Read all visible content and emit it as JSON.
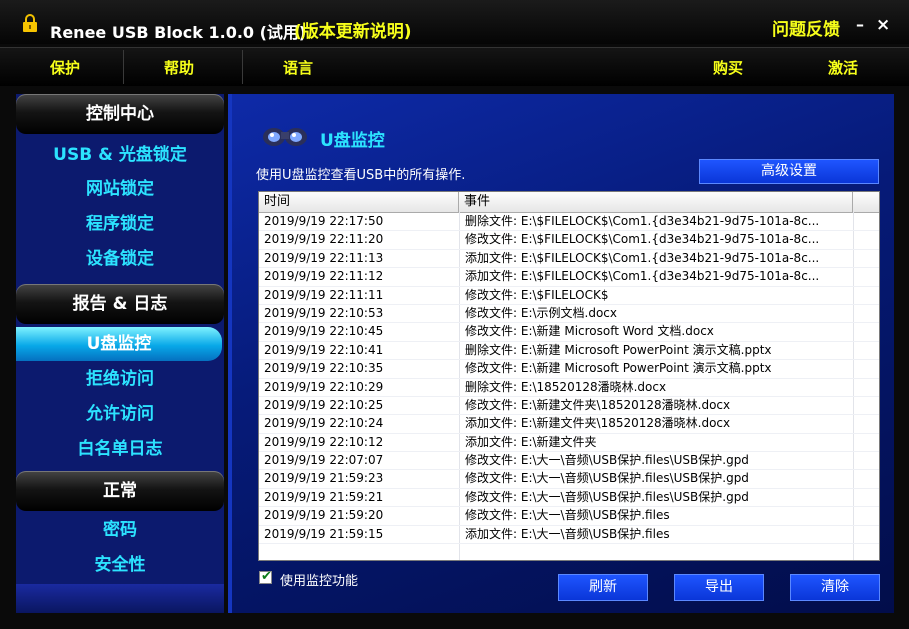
{
  "titlebar": {
    "app_name": "Renee USB Block 1.0.0 (试用)",
    "update_link": "(版本更新说明)",
    "feedback": "问题反馈",
    "minimize": "–",
    "close": "×"
  },
  "menu": {
    "protect": "保护",
    "help": "帮助",
    "language": "语言",
    "buy": "购买",
    "activate": "激活"
  },
  "sidebar": {
    "control_header": "控制中心",
    "control_items": [
      "USB & 光盘锁定",
      "网站锁定",
      "程序锁定",
      "设备锁定"
    ],
    "report_header": "报告 & 日志",
    "report_items": [
      "U盘监控",
      "拒绝访问",
      "允许访问",
      "白名单日志"
    ],
    "general_header": "正常",
    "general_items": [
      "密码",
      "安全性"
    ]
  },
  "main": {
    "title": "U盘监控",
    "description": "使用U盘监控查看USB中的所有操作.",
    "advanced_button": "高级设置",
    "columns": [
      "时间",
      "事件"
    ],
    "rows": [
      {
        "time": "2019/9/19 22:17:50",
        "event": "删除文件: E:\\$FILELOCK$\\Com1.{d3e34b21-9d75-101a-8c..."
      },
      {
        "time": "2019/9/19 22:11:20",
        "event": "修改文件: E:\\$FILELOCK$\\Com1.{d3e34b21-9d75-101a-8c..."
      },
      {
        "time": "2019/9/19 22:11:13",
        "event": "添加文件: E:\\$FILELOCK$\\Com1.{d3e34b21-9d75-101a-8c..."
      },
      {
        "time": "2019/9/19 22:11:12",
        "event": "添加文件: E:\\$FILELOCK$\\Com1.{d3e34b21-9d75-101a-8c..."
      },
      {
        "time": "2019/9/19 22:11:11",
        "event": "修改文件: E:\\$FILELOCK$"
      },
      {
        "time": "2019/9/19 22:10:53",
        "event": "修改文件: E:\\示例文档.docx"
      },
      {
        "time": "2019/9/19 22:10:45",
        "event": "修改文件: E:\\新建 Microsoft Word 文档.docx"
      },
      {
        "time": "2019/9/19 22:10:41",
        "event": "删除文件: E:\\新建 Microsoft PowerPoint 演示文稿.pptx"
      },
      {
        "time": "2019/9/19 22:10:35",
        "event": "修改文件: E:\\新建 Microsoft PowerPoint 演示文稿.pptx"
      },
      {
        "time": "2019/9/19 22:10:29",
        "event": "删除文件: E:\\18520128潘晓林.docx"
      },
      {
        "time": "2019/9/19 22:10:25",
        "event": "修改文件: E:\\新建文件夹\\18520128潘晓林.docx"
      },
      {
        "time": "2019/9/19 22:10:24",
        "event": "添加文件: E:\\新建文件夹\\18520128潘晓林.docx"
      },
      {
        "time": "2019/9/19 22:10:12",
        "event": "添加文件: E:\\新建文件夹"
      },
      {
        "time": "2019/9/19 22:07:07",
        "event": "修改文件: E:\\大一\\音频\\USB保护.files\\USB保护.gpd"
      },
      {
        "time": "2019/9/19 21:59:23",
        "event": "修改文件: E:\\大一\\音频\\USB保护.files\\USB保护.gpd"
      },
      {
        "time": "2019/9/19 21:59:21",
        "event": "修改文件: E:\\大一\\音频\\USB保护.files\\USB保护.gpd"
      },
      {
        "time": "2019/9/19 21:59:20",
        "event": "修改文件: E:\\大一\\音频\\USB保护.files"
      },
      {
        "time": "2019/9/19 21:59:15",
        "event": "添加文件: E:\\大一\\音频\\USB保护.files"
      }
    ],
    "monitor_checkbox": "使用监控功能",
    "monitor_checked": true,
    "refresh_button": "刷新",
    "export_button": "导出",
    "clear_button": "清除"
  },
  "colors": {
    "accent_yellow": "#f7ff1a",
    "accent_cyan": "#2ce3ff",
    "panel_blue": "#0e2aa8",
    "button_blue": "#1f55ff"
  }
}
